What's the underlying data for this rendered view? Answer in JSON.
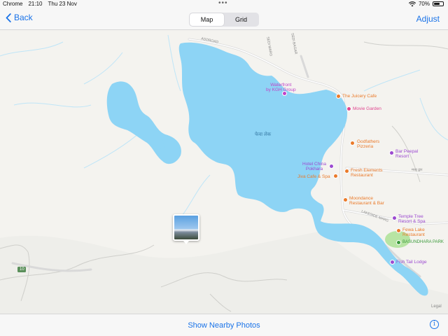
{
  "status_bar": {
    "app": "Chrome",
    "time": "21:10",
    "date": "Thu 23 Nov",
    "more": "•••",
    "battery_percent": "70%",
    "battery_level": 0.7
  },
  "nav": {
    "back_label": "Back",
    "segments": [
      "Map",
      "Grid"
    ],
    "selected_segment": "Map",
    "adjust_label": "Adjust"
  },
  "map": {
    "lake_label": "फेवा लेक",
    "road_labels": [
      "ADDROAD",
      "SEDI BAGAR",
      "SEDI MARG",
      "LAKESIDE MARG",
      "मध्य द्वार",
      "10",
      "Legal"
    ],
    "places": [
      {
        "name": "Waterfront by KGH Group",
        "lines": [
          "Waterfront",
          "by KGH Group"
        ],
        "color": "#c044c8"
      },
      {
        "name": "The Juicery Cafe",
        "lines": [
          "The Juicery Cafe"
        ],
        "color": "#ea7a2a"
      },
      {
        "name": "Movie Garden",
        "lines": [
          "Movie Garden"
        ],
        "color": "#e0478f"
      },
      {
        "name": "Godfathers Pizzeria",
        "lines": [
          "Godfathers",
          "Pizzeria"
        ],
        "color": "#ea7a2a"
      },
      {
        "name": "Bar Peepal Resort",
        "lines": [
          "Bar Peepal",
          "Resort"
        ],
        "color": "#9c4ad0"
      },
      {
        "name": "Hotel China Pokhara",
        "lines": [
          "Hotel China",
          "Pokhara"
        ],
        "color": "#9c4ad0"
      },
      {
        "name": "Fresh Elements Restaurant",
        "lines": [
          "Fresh Elements",
          "Restaurant"
        ],
        "color": "#ea7a2a"
      },
      {
        "name": "Jiva Cafe & Spa",
        "lines": [
          "Jiva Cafe & Spa"
        ],
        "color": "#ea7a2a"
      },
      {
        "name": "Moondance Restaurant & Bar",
        "lines": [
          "Moondance",
          "Restaurant & Bar"
        ],
        "color": "#ea7a2a"
      },
      {
        "name": "Temple Tree Resort & Spa",
        "lines": [
          "Temple Tree",
          "Resort & Spa"
        ],
        "color": "#9c4ad0"
      },
      {
        "name": "Fewa Lake Restaurant",
        "lines": [
          "Fewa Lake",
          "Restaurant"
        ],
        "color": "#ea7a2a"
      },
      {
        "name": "BASUNDHARA PARK",
        "lines": [
          "BASUNDHARA PARK"
        ],
        "color": "#3a9a3a"
      },
      {
        "name": "Fish Tail Lodge",
        "lines": [
          "Fish Tail Lodge"
        ],
        "color": "#9c4ad0"
      }
    ]
  },
  "bottom": {
    "nearby_label": "Show Nearby Photos",
    "info_label": "i"
  },
  "colors": {
    "accent": "#1a73e8",
    "water": "#8dd4f5",
    "land": "#f4f3ef",
    "park": "#b7e4a3"
  },
  "icons": [
    "chevron-left-icon",
    "wifi-icon",
    "battery-icon",
    "info-icon",
    "photo-thumbnail"
  ]
}
